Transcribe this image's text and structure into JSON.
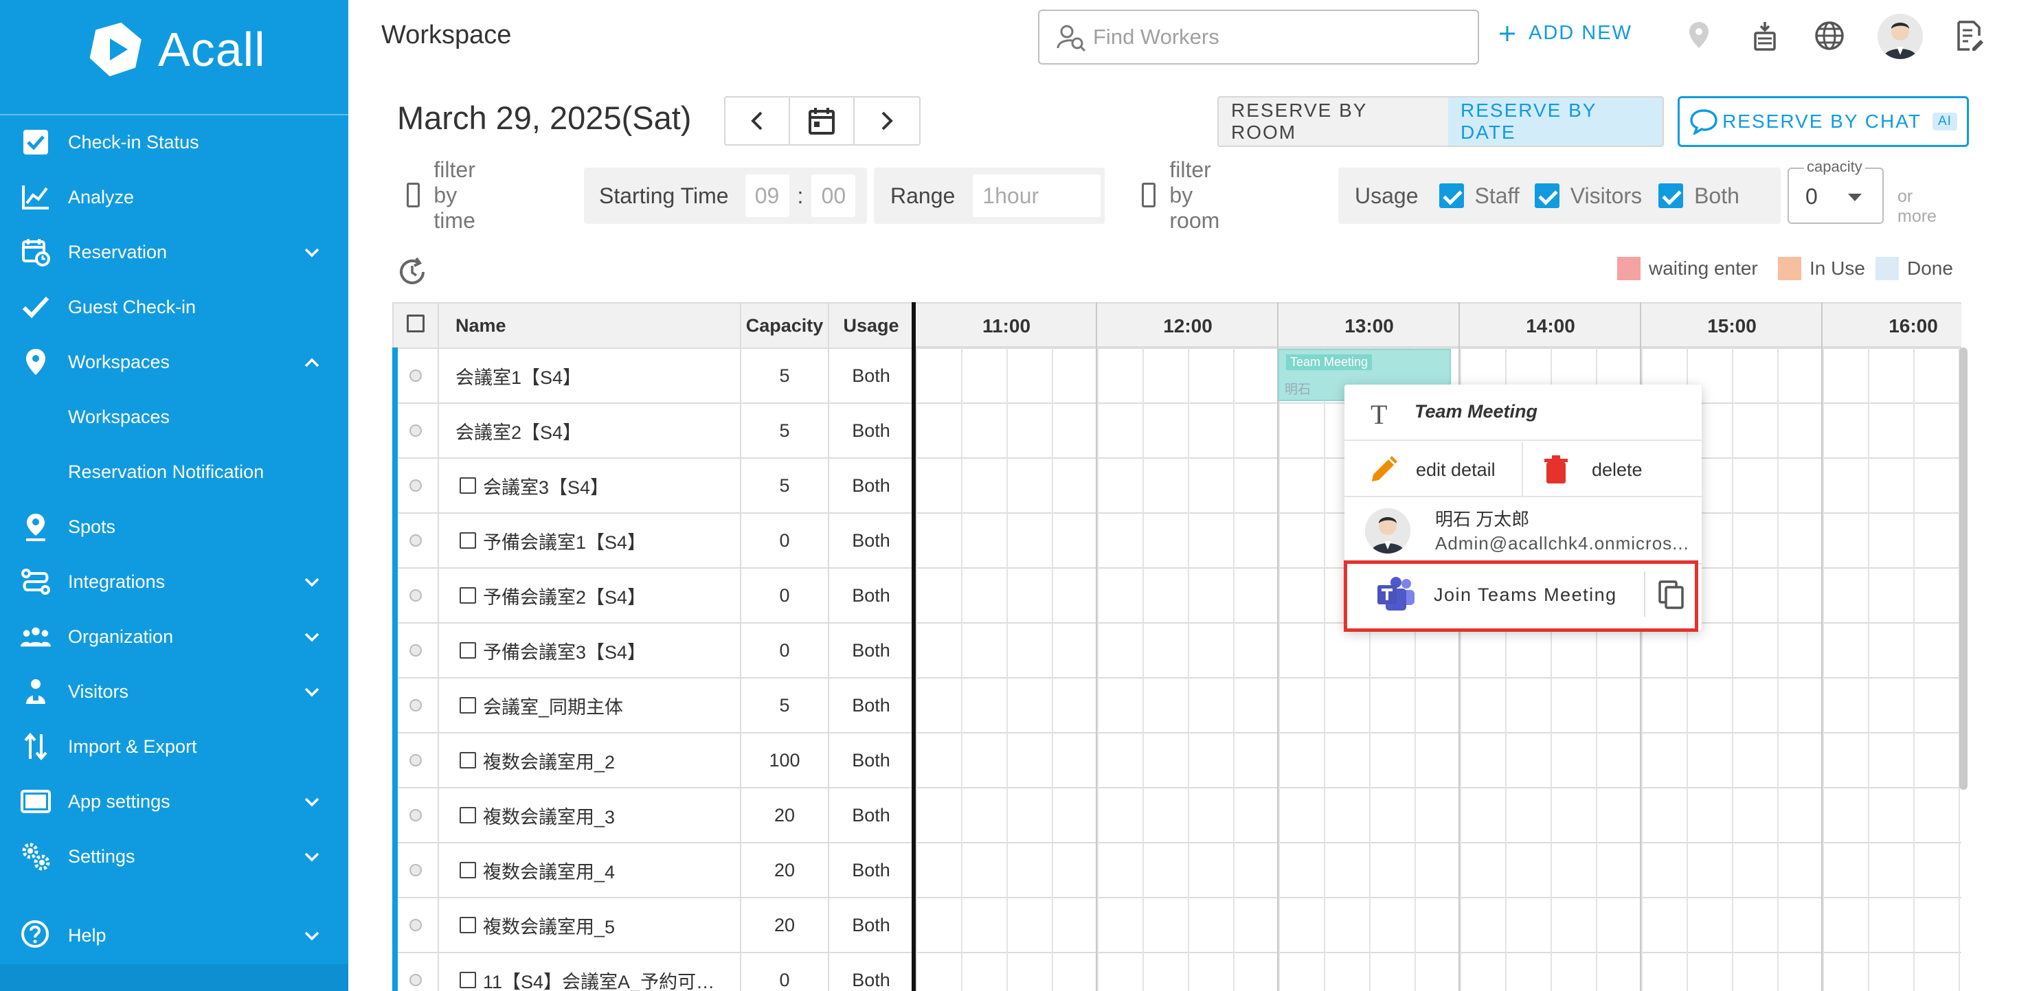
{
  "app": {
    "logo_text": "Acall"
  },
  "sidebar": {
    "items": [
      {
        "label": "Check-in Status"
      },
      {
        "label": "Analyze"
      },
      {
        "label": "Reservation"
      },
      {
        "label": "Guest Check-in"
      },
      {
        "label": "Workspaces"
      },
      {
        "label": "Workspaces"
      },
      {
        "label": "Reservation Notification"
      },
      {
        "label": "Spots"
      },
      {
        "label": "Integrations"
      },
      {
        "label": "Organization"
      },
      {
        "label": "Visitors"
      },
      {
        "label": "Import & Export"
      },
      {
        "label": "App settings"
      },
      {
        "label": "Settings"
      }
    ],
    "help_label": "Help"
  },
  "header": {
    "title": "Workspace",
    "search_placeholder": "Find Workers",
    "add_new_label": "ADD NEW"
  },
  "date_bar": {
    "date": "March 29, 2025(Sat)",
    "reserve_by_room": "RESERVE BY ROOM",
    "reserve_by_date": "RESERVE BY DATE",
    "reserve_by_chat": "RESERVE BY CHAT",
    "ai_badge": "AI"
  },
  "filters": {
    "filter_by_time": "filter by time",
    "starting_time_label": "Starting Time",
    "hour_placeholder": "09",
    "time_sep": ":",
    "minute_placeholder": "00",
    "range_label": "Range",
    "range_placeholder": "1hour",
    "filter_by_room": "filter by room",
    "usage_label": "Usage",
    "staff_label": "Staff",
    "visitors_label": "Visitors",
    "both_label": "Both",
    "capacity_label": "capacity",
    "capacity_value": "0",
    "or_more": "or more"
  },
  "legend": {
    "waiting_enter": "waiting enter",
    "in_use": "In Use",
    "done": "Done",
    "colors": {
      "waiting_enter": "#f4a2a2",
      "in_use": "#f7bf9e",
      "done": "#dbeaf6"
    }
  },
  "table": {
    "headers": {
      "name": "Name",
      "capacity": "Capacity",
      "usage": "Usage"
    },
    "hours": [
      "11:00",
      "12:00",
      "13:00",
      "14:00",
      "15:00",
      "16:00"
    ],
    "rows": [
      {
        "name": "会議室1【S4】",
        "capacity": "5",
        "usage": "Both",
        "checkbox": false
      },
      {
        "name": "会議室2【S4】",
        "capacity": "5",
        "usage": "Both",
        "checkbox": false
      },
      {
        "name": "会議室3【S4】",
        "capacity": "5",
        "usage": "Both",
        "checkbox": true
      },
      {
        "name": "予備会議室1【S4】",
        "capacity": "0",
        "usage": "Both",
        "checkbox": true
      },
      {
        "name": "予備会議室2【S4】",
        "capacity": "0",
        "usage": "Both",
        "checkbox": true
      },
      {
        "name": "予備会議室3【S4】",
        "capacity": "0",
        "usage": "Both",
        "checkbox": true
      },
      {
        "name": "会議室_同期主体",
        "capacity": "5",
        "usage": "Both",
        "checkbox": true
      },
      {
        "name": "複数会議室用_2",
        "capacity": "100",
        "usage": "Both",
        "checkbox": true
      },
      {
        "name": "複数会議室用_3",
        "capacity": "20",
        "usage": "Both",
        "checkbox": true
      },
      {
        "name": "複数会議室用_4",
        "capacity": "20",
        "usage": "Both",
        "checkbox": true
      },
      {
        "name": "複数会議室用_5",
        "capacity": "20",
        "usage": "Both",
        "checkbox": true
      },
      {
        "name": "11【S4】会議室A_予約可…",
        "capacity": "0",
        "usage": "Both",
        "checkbox": true
      }
    ]
  },
  "booking": {
    "owner_short": "明石"
  },
  "popup": {
    "title": "Team Meeting",
    "edit_label": "edit detail",
    "delete_label": "delete",
    "user_name": "明石 万太郎",
    "user_email": "Admin@acallchk4.onmicros...",
    "join_label": "Join Teams Meeting"
  },
  "colors": {
    "brand": "#109be0",
    "highlight": "#e5322d",
    "delete": "#e5322d",
    "edit": "#f08c00",
    "teams": "#5059c9"
  }
}
